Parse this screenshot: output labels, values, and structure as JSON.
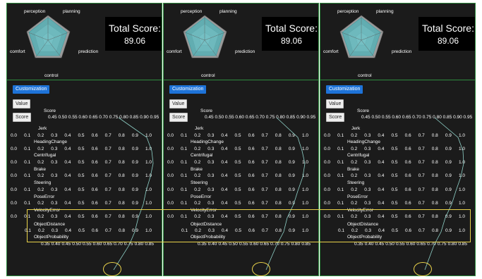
{
  "panels": [
    {
      "radar": {
        "perception": "perception",
        "planning": "planning",
        "prediction": "prediction",
        "control": "control",
        "comfort": "comfort"
      },
      "total_score": {
        "label": "Total Score:",
        "value": "89.06"
      },
      "customization_label": "Customization",
      "value_button": "Value",
      "score_button": "Score",
      "sliders": [
        {
          "name": "Score",
          "ticks": [
            "0.45",
            "0.50",
            "0.55",
            "0.60",
            "0.65",
            "0.70",
            "0.75",
            "0.80",
            "0.85",
            "0.90",
            "0.95"
          ]
        },
        {
          "name": "Jerk",
          "ticks": [
            "0.0",
            "0.1",
            "0.2",
            "0.3",
            "0.4",
            "0.5",
            "0.6",
            "0.7",
            "0.8",
            "0.9",
            "1.0"
          ]
        },
        {
          "name": "HeadingChange",
          "ticks": [
            "0.0",
            "0.1",
            "0.2",
            "0.3",
            "0.4",
            "0.5",
            "0.6",
            "0.7",
            "0.8",
            "0.9",
            "1.0"
          ]
        },
        {
          "name": "Centrifugal",
          "ticks": [
            "0.0",
            "0.1",
            "0.2",
            "0.3",
            "0.4",
            "0.5",
            "0.6",
            "0.7",
            "0.8",
            "0.9",
            "1.0"
          ]
        },
        {
          "name": "Brake",
          "ticks": [
            "0.0",
            "0.1",
            "0.2",
            "0.3",
            "0.4",
            "0.5",
            "0.6",
            "0.7",
            "0.8",
            "0.9",
            "1.0"
          ]
        },
        {
          "name": "Steering",
          "ticks": [
            "0.0",
            "0.1",
            "0.2",
            "0.3",
            "0.4",
            "0.5",
            "0.6",
            "0.7",
            "0.8",
            "0.9",
            "1.0"
          ]
        },
        {
          "name": "PoseError",
          "ticks": [
            "0.0",
            "0.1",
            "0.2",
            "0.3",
            "0.4",
            "0.5",
            "0.6",
            "0.7",
            "0.8",
            "0.9",
            "1.0"
          ]
        },
        {
          "name": "VelocityError",
          "ticks": [
            "0.0",
            "0.1",
            "0.2",
            "0.3",
            "0.4",
            "0.5",
            "0.6",
            "0.7",
            "0.8",
            "0.9",
            "1.0"
          ]
        },
        {
          "name": "ObjectDistance",
          "ticks": [
            "0.1",
            "0.2",
            "0.3",
            "0.4",
            "0.5",
            "0.6",
            "0.7",
            "0.8",
            "0.9",
            "1.0"
          ]
        },
        {
          "name": "ObjectProbability",
          "ticks": [
            "0.35",
            "0.40",
            "0.45",
            "0.50",
            "0.55",
            "0.60",
            "0.65",
            "0.70",
            "0.75",
            "0.80",
            "0.85"
          ]
        }
      ]
    },
    {
      "radar": {
        "perception": "perception",
        "planning": "planning",
        "prediction": "prediction",
        "control": "control",
        "comfort": "comfort"
      },
      "total_score": {
        "label": "Total Score:",
        "value": "89.06"
      },
      "customization_label": "Customization",
      "value_button": "Value",
      "score_button": "Score",
      "sliders": [
        {
          "name": "Score",
          "ticks": [
            "0.45",
            "0.50",
            "0.55",
            "0.60",
            "0.65",
            "0.70",
            "0.75",
            "0.80",
            "0.85",
            "0.90",
            "0.95"
          ]
        },
        {
          "name": "Jerk",
          "ticks": [
            "0.0",
            "0.1",
            "0.2",
            "0.3",
            "0.4",
            "0.5",
            "0.6",
            "0.7",
            "0.8",
            "0.9",
            "1.0"
          ]
        },
        {
          "name": "HeadingChange",
          "ticks": [
            "0.0",
            "0.1",
            "0.2",
            "0.3",
            "0.4",
            "0.5",
            "0.6",
            "0.7",
            "0.8",
            "0.9",
            "1.0"
          ]
        },
        {
          "name": "Centrifugal",
          "ticks": [
            "0.0",
            "0.1",
            "0.2",
            "0.3",
            "0.4",
            "0.5",
            "0.6",
            "0.7",
            "0.8",
            "0.9",
            "1.0"
          ]
        },
        {
          "name": "Brake",
          "ticks": [
            "0.0",
            "0.1",
            "0.2",
            "0.3",
            "0.4",
            "0.5",
            "0.6",
            "0.7",
            "0.8",
            "0.9",
            "1.0"
          ]
        },
        {
          "name": "Steering",
          "ticks": [
            "0.0",
            "0.1",
            "0.2",
            "0.3",
            "0.4",
            "0.5",
            "0.6",
            "0.7",
            "0.8",
            "0.9",
            "1.0"
          ]
        },
        {
          "name": "PoseError",
          "ticks": [
            "0.0",
            "0.1",
            "0.2",
            "0.3",
            "0.4",
            "0.5",
            "0.6",
            "0.7",
            "0.8",
            "0.9",
            "1.0"
          ]
        },
        {
          "name": "VelocityError",
          "ticks": [
            "0.0",
            "0.1",
            "0.2",
            "0.3",
            "0.4",
            "0.5",
            "0.6",
            "0.7",
            "0.8",
            "0.9",
            "1.0"
          ]
        },
        {
          "name": "ObjectDistance",
          "ticks": [
            "0.1",
            "0.2",
            "0.3",
            "0.4",
            "0.5",
            "0.6",
            "0.7",
            "0.8",
            "0.9",
            "1.0"
          ]
        },
        {
          "name": "ObjectProbability",
          "ticks": [
            "0.35",
            "0.40",
            "0.45",
            "0.50",
            "0.55",
            "0.60",
            "0.65",
            "0.70",
            "0.75",
            "0.80",
            "0.85"
          ]
        }
      ]
    },
    {
      "radar": {
        "perception": "perception",
        "planning": "planning",
        "prediction": "prediction",
        "control": "control",
        "comfort": "comfort"
      },
      "total_score": {
        "label": "Total Score:",
        "value": "89.06"
      },
      "customization_label": "Customization",
      "value_button": "Value",
      "score_button": "Score",
      "sliders": [
        {
          "name": "Score",
          "ticks": [
            "0.45",
            "0.50",
            "0.55",
            "0.60",
            "0.65",
            "0.70",
            "0.75",
            "0.80",
            "0.85",
            "0.90",
            "0.95"
          ]
        },
        {
          "name": "Jerk",
          "ticks": [
            "0.0",
            "0.1",
            "0.2",
            "0.3",
            "0.4",
            "0.5",
            "0.6",
            "0.7",
            "0.8",
            "0.9",
            "1.0"
          ]
        },
        {
          "name": "HeadingChange",
          "ticks": [
            "0.0",
            "0.1",
            "0.2",
            "0.3",
            "0.4",
            "0.5",
            "0.6",
            "0.7",
            "0.8",
            "0.9",
            "1.0"
          ]
        },
        {
          "name": "Centrifugal",
          "ticks": [
            "0.0",
            "0.1",
            "0.2",
            "0.3",
            "0.4",
            "0.5",
            "0.6",
            "0.7",
            "0.8",
            "0.9",
            "1.0"
          ]
        },
        {
          "name": "Brake",
          "ticks": [
            "0.0",
            "0.1",
            "0.2",
            "0.3",
            "0.4",
            "0.5",
            "0.6",
            "0.7",
            "0.8",
            "0.9",
            "1.0"
          ]
        },
        {
          "name": "Steering",
          "ticks": [
            "0.0",
            "0.1",
            "0.2",
            "0.3",
            "0.4",
            "0.5",
            "0.6",
            "0.7",
            "0.8",
            "0.9",
            "1.0"
          ]
        },
        {
          "name": "PoseError",
          "ticks": [
            "0.0",
            "0.1",
            "0.2",
            "0.3",
            "0.4",
            "0.5",
            "0.6",
            "0.7",
            "0.8",
            "0.9",
            "1.0"
          ]
        },
        {
          "name": "VelocityError",
          "ticks": [
            "0.0",
            "0.1",
            "0.2",
            "0.3",
            "0.4",
            "0.5",
            "0.6",
            "0.7",
            "0.8",
            "0.9",
            "1.0"
          ]
        },
        {
          "name": "ObjectDistance",
          "ticks": [
            "0.1",
            "0.2",
            "0.3",
            "0.4",
            "0.5",
            "0.6",
            "0.7",
            "0.8",
            "0.9",
            "1.0"
          ]
        },
        {
          "name": "ObjectProbability",
          "ticks": [
            "0.35",
            "0.40",
            "0.45",
            "0.50",
            "0.55",
            "0.60",
            "0.65",
            "0.70",
            "0.75",
            "0.80",
            "0.85"
          ]
        }
      ]
    }
  ],
  "colors": {
    "panel_bg": "#1b1b1b",
    "border": "#2e8b3e",
    "accent": "#1e73d8",
    "radar_fill": "#4fb3b8",
    "highlight": "#ead34a",
    "curve": "#8fd1c8"
  }
}
